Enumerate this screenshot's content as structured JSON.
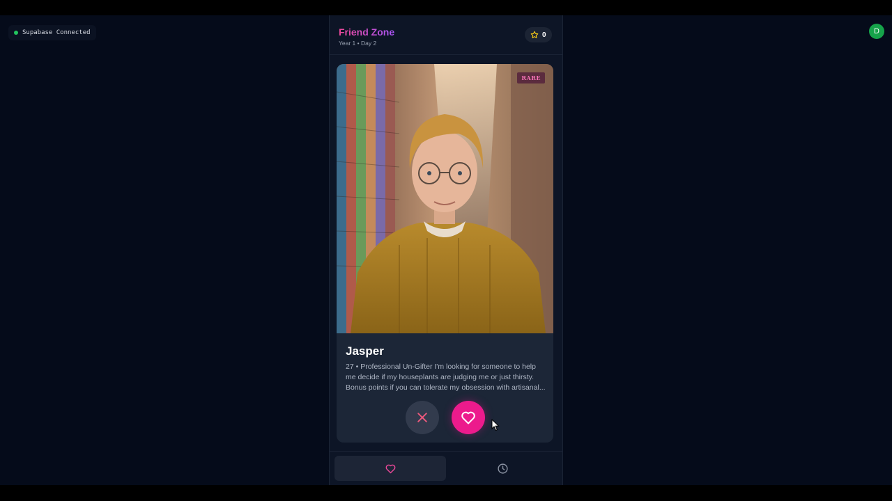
{
  "status": {
    "label": "Supabase Connected",
    "color": "#22c55e"
  },
  "user": {
    "initial": "D"
  },
  "header": {
    "title": "Friend Zone",
    "subtitle": "Year 1 • Day 2",
    "score": "0",
    "score_icon": "star-icon"
  },
  "card": {
    "rarity": "RARE",
    "name": "Jasper",
    "bio": "27 • Professional Un-Gifter I'm looking for someone to help me decide if my houseplants are judging me or just thirsty. Bonus points if you can tolerate my obsession with artisanal...",
    "pass_icon": "close-icon",
    "like_icon": "heart-icon"
  },
  "nav": {
    "swipe_icon": "heart-icon",
    "history_icon": "clock-icon"
  },
  "colors": {
    "accent": "#ec1b8c",
    "background": "#050b1a",
    "panel": "#0d1526",
    "card": "#1c2637"
  }
}
